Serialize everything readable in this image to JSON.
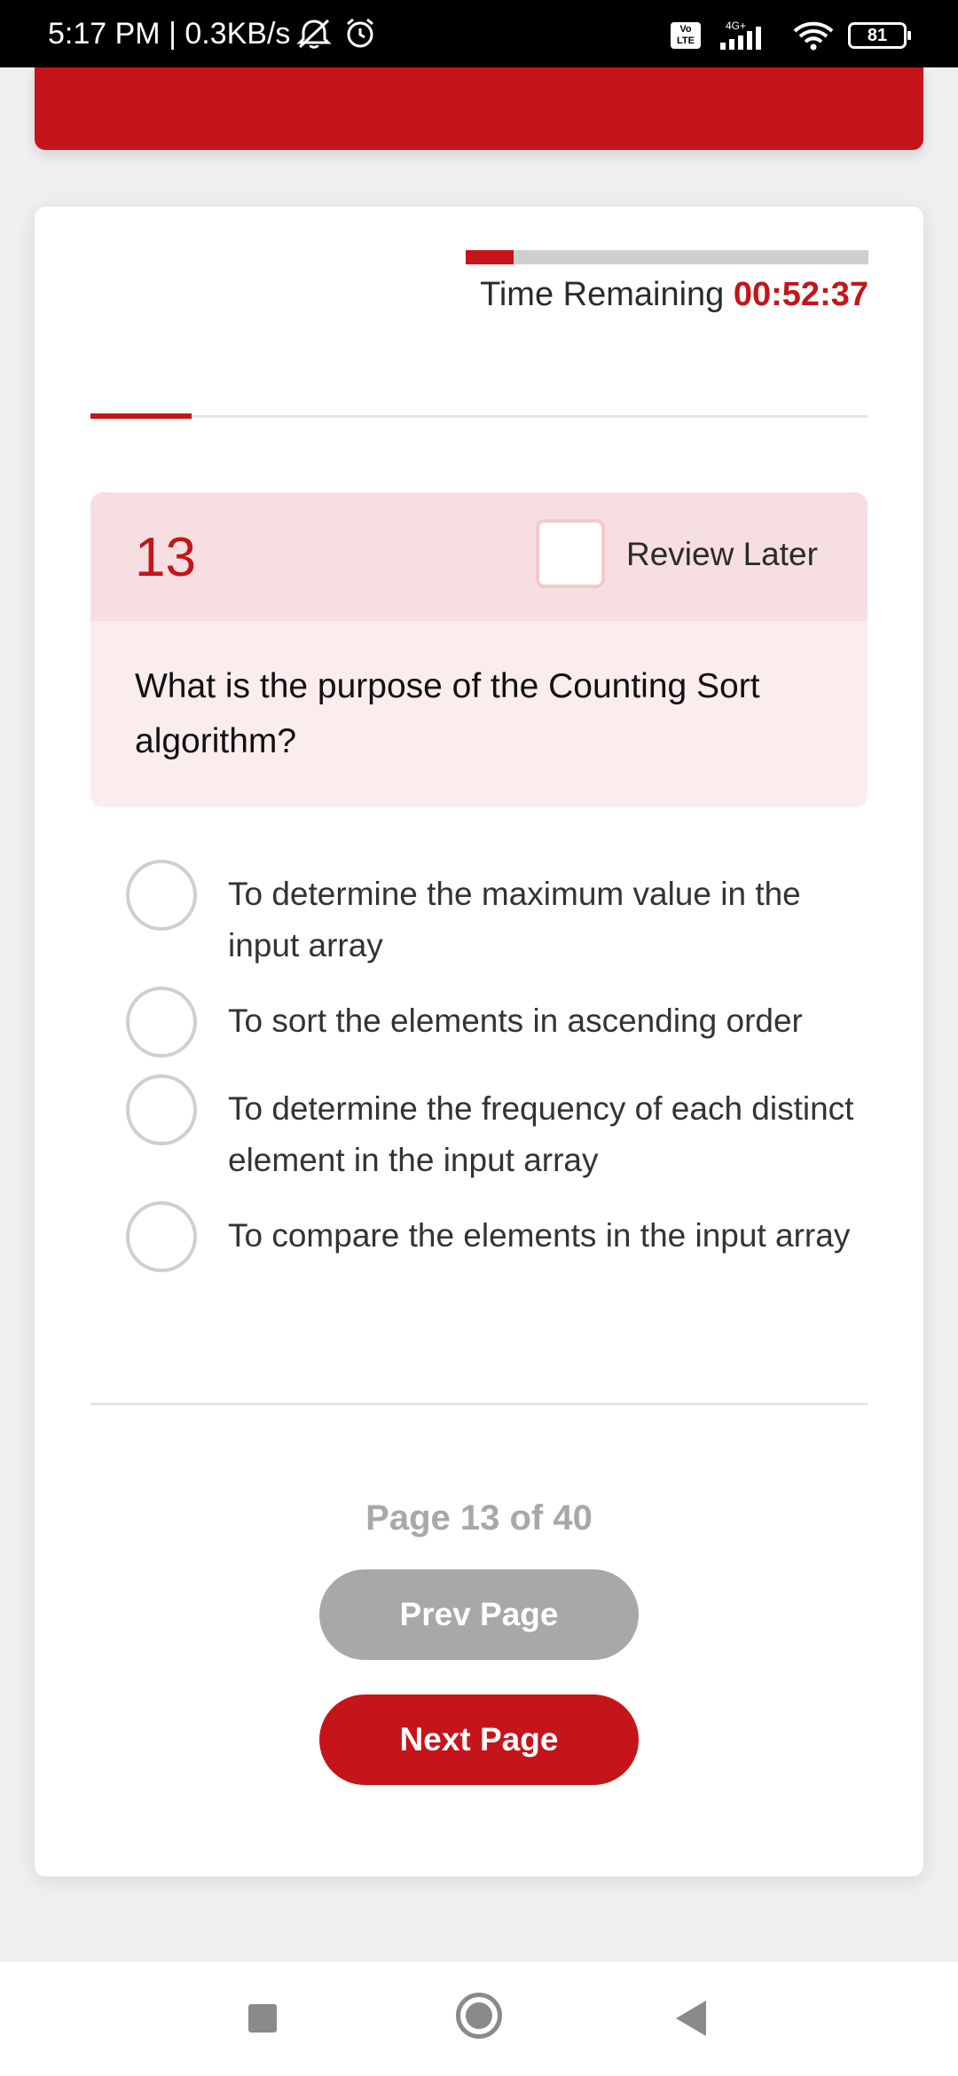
{
  "status_bar": {
    "time_speed": "5:17 PM | 0.3KB/s",
    "network": "4G+",
    "volte": "Vo LTE",
    "battery": "81"
  },
  "quiz": {
    "timer_label": "Time Remaining",
    "timer_value": "00:52:37",
    "timer_fraction_elapsed": 0.12,
    "progress_fraction": 0.13,
    "question_number": "13",
    "review_label": "Review Later",
    "review_checked": false,
    "question_text": "What is the purpose of the Counting Sort algorithm?",
    "options": [
      {
        "label": "To determine the maximum value in the input array",
        "selected": false
      },
      {
        "label": "To sort the elements in ascending order",
        "selected": false
      },
      {
        "label": "To determine the frequency of each distinct element in the input array",
        "selected": false
      },
      {
        "label": "To compare the elements in the input array",
        "selected": false
      }
    ]
  },
  "pagination": {
    "page_text": "Page 13 of 40",
    "prev_label": "Prev Page",
    "next_label": "Next Page"
  },
  "colors": {
    "accent": "#c5141a",
    "question_header_bg": "#f7dfe1",
    "question_body_bg": "#fbeced",
    "disabled_button": "#a8a8a8"
  }
}
